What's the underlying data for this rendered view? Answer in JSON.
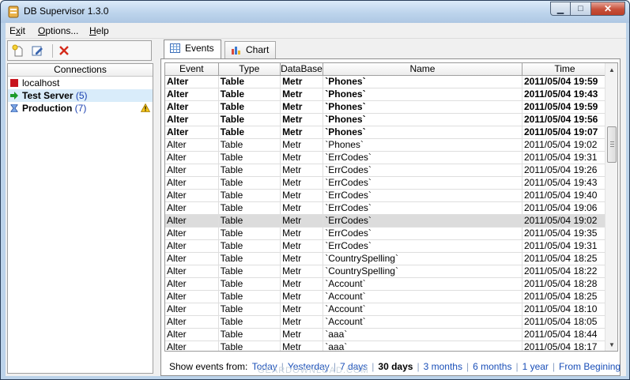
{
  "window": {
    "title": "DB Supervisor 1.3.0"
  },
  "menu": [
    {
      "pre": "E",
      "ul": "x",
      "post": "it"
    },
    {
      "pre": "",
      "ul": "O",
      "post": "ptions..."
    },
    {
      "pre": "",
      "ul": "H",
      "post": "elp"
    }
  ],
  "toolbar": {
    "icons": [
      "new-connection-icon",
      "edit-connection-icon",
      "delete-connection-icon"
    ]
  },
  "connections": {
    "header": "Connections",
    "items": [
      {
        "name": "localhost",
        "count": "",
        "status_icon": "stopped-square-icon",
        "bold": false,
        "selected": false,
        "warning": false
      },
      {
        "name": "Test Server",
        "count": "(5)",
        "status_icon": "running-arrow-icon",
        "bold": true,
        "selected": true,
        "warning": false
      },
      {
        "name": "Production",
        "count": "(7)",
        "status_icon": "hourglass-icon",
        "bold": true,
        "selected": false,
        "warning": true
      }
    ]
  },
  "tabs": [
    {
      "label": "Events",
      "icon": "grid-icon",
      "active": true
    },
    {
      "label": "Chart",
      "icon": "bar-chart-icon",
      "active": false
    }
  ],
  "grid": {
    "columns": [
      "Event",
      "Type",
      "DataBase",
      "Name",
      "Time"
    ],
    "rows": [
      {
        "cells": [
          "Alter",
          "Table",
          "Metr",
          "`Phones`",
          "2011/05/04 19:59"
        ],
        "bold": true
      },
      {
        "cells": [
          "Alter",
          "Table",
          "Metr",
          "`Phones`",
          "2011/05/04 19:43"
        ],
        "bold": true
      },
      {
        "cells": [
          "Alter",
          "Table",
          "Metr",
          "`Phones`",
          "2011/05/04 19:59"
        ],
        "bold": true
      },
      {
        "cells": [
          "Alter",
          "Table",
          "Metr",
          "`Phones`",
          "2011/05/04 19:56"
        ],
        "bold": true
      },
      {
        "cells": [
          "Alter",
          "Table",
          "Metr",
          "`Phones`",
          "2011/05/04 19:07"
        ],
        "bold": true
      },
      {
        "cells": [
          "Alter",
          "Table",
          "Metr",
          "`Phones`",
          "2011/05/04 19:02"
        ],
        "bold": false
      },
      {
        "cells": [
          "Alter",
          "Table",
          "Metr",
          "`ErrCodes`",
          "2011/05/04 19:31"
        ],
        "bold": false
      },
      {
        "cells": [
          "Alter",
          "Table",
          "Metr",
          "`ErrCodes`",
          "2011/05/04 19:26"
        ],
        "bold": false
      },
      {
        "cells": [
          "Alter",
          "Table",
          "Metr",
          "`ErrCodes`",
          "2011/05/04 19:43"
        ],
        "bold": false
      },
      {
        "cells": [
          "Alter",
          "Table",
          "Metr",
          "`ErrCodes`",
          "2011/05/04 19:40"
        ],
        "bold": false
      },
      {
        "cells": [
          "Alter",
          "Table",
          "Metr",
          "`ErrCodes`",
          "2011/05/04 19:06"
        ],
        "bold": false
      },
      {
        "cells": [
          "Alter",
          "Table",
          "Metr",
          "`ErrCodes`",
          "2011/05/04 19:02"
        ],
        "bold": false,
        "highlight": true
      },
      {
        "cells": [
          "Alter",
          "Table",
          "Metr",
          "`ErrCodes`",
          "2011/05/04 19:35"
        ],
        "bold": false
      },
      {
        "cells": [
          "Alter",
          "Table",
          "Metr",
          "`ErrCodes`",
          "2011/05/04 19:31"
        ],
        "bold": false
      },
      {
        "cells": [
          "Alter",
          "Table",
          "Metr",
          "`CountrySpelling`",
          "2011/05/04 18:25"
        ],
        "bold": false
      },
      {
        "cells": [
          "Alter",
          "Table",
          "Metr",
          "`CountrySpelling`",
          "2011/05/04 18:22"
        ],
        "bold": false
      },
      {
        "cells": [
          "Alter",
          "Table",
          "Metr",
          "`Account`",
          "2011/05/04 18:28"
        ],
        "bold": false
      },
      {
        "cells": [
          "Alter",
          "Table",
          "Metr",
          "`Account`",
          "2011/05/04 18:25"
        ],
        "bold": false
      },
      {
        "cells": [
          "Alter",
          "Table",
          "Metr",
          "`Account`",
          "2011/05/04 18:10"
        ],
        "bold": false
      },
      {
        "cells": [
          "Alter",
          "Table",
          "Metr",
          "`Account`",
          "2011/05/04 18:05"
        ],
        "bold": false
      },
      {
        "cells": [
          "Alter",
          "Table",
          "Metr",
          "`aaa`",
          "2011/05/04 18:44"
        ],
        "bold": false
      },
      {
        "cells": [
          "Alter",
          "Table",
          "Metr",
          "`aaa`",
          "2011/05/04 18:17"
        ],
        "bold": false
      }
    ]
  },
  "filter": {
    "label": "Show events from:",
    "options": [
      {
        "label": "Today",
        "current": false
      },
      {
        "label": "Yesterday",
        "current": false
      },
      {
        "label": "7 days",
        "current": false
      },
      {
        "label": "30 days",
        "current": true
      },
      {
        "label": "3 months",
        "current": false
      },
      {
        "label": "6 months",
        "current": false
      },
      {
        "label": "1 year",
        "current": false
      },
      {
        "label": "From Begining",
        "current": false
      }
    ]
  },
  "colors": {
    "link": "#1a4fb8",
    "selection": "#d9ecfa",
    "row_highlight": "#dcdcdc",
    "close_button": "#c7503a"
  },
  "watermark": "GEARDOWNLOAD.COM"
}
